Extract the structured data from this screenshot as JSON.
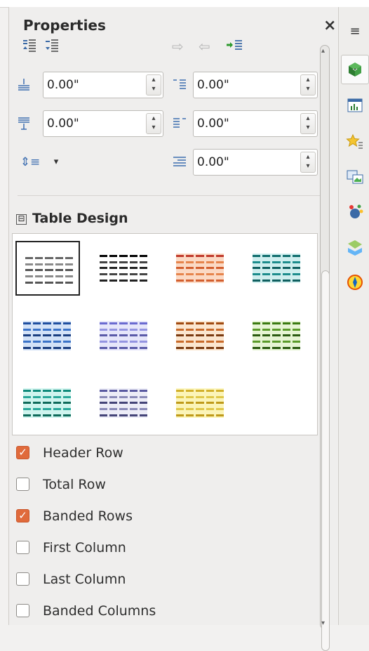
{
  "panel": {
    "title": "Properties",
    "close_glyph": "×"
  },
  "toolbar": {
    "icons": [
      "insert-rows-above-icon",
      "insert-rows-below-icon",
      "indent-increase-icon",
      "indent-decrease-icon",
      "paragraph-after-icon"
    ]
  },
  "spacing": {
    "above": "0.00\"",
    "below": "0.00\"",
    "indent_before": "0.00\"",
    "indent_after": "0.00\"",
    "first_line": "0.00\"",
    "line_spacing_glyph": "⇕≡",
    "dropdown_glyph": "▾"
  },
  "table_design": {
    "title": "Table Design",
    "toggle_glyph": "⊟",
    "styles": [
      {
        "header": "#666666",
        "body": "#8a8a8a",
        "alt": "#555555",
        "bg": "#ffffff",
        "selected": true
      },
      {
        "header": "#000000",
        "body": "#444444",
        "alt": "#222222",
        "bg": "#ffffff",
        "selected": false
      },
      {
        "header": "#c0392b",
        "body": "#e6844c",
        "alt": "#d35f2f",
        "bg": "#fbd9c4",
        "selected": false
      },
      {
        "header": "#0f6c6c",
        "body": "#1c8c8c",
        "alt": "#0f5f5f",
        "bg": "#cfeeee",
        "selected": false
      },
      {
        "header": "#1f4fa0",
        "body": "#3a73c8",
        "alt": "#1a3e80",
        "bg": "#d3e2f7",
        "selected": false
      },
      {
        "header": "#6a6ad0",
        "body": "#9494e0",
        "alt": "#5a5aa8",
        "bg": "#e6e6fa",
        "selected": false
      },
      {
        "header": "#a04a10",
        "body": "#c86a2a",
        "alt": "#7a3a10",
        "bg": "#fbe6cf",
        "selected": false
      },
      {
        "header": "#3a7a10",
        "body": "#5a9a2a",
        "alt": "#2a5a10",
        "bg": "#e6f4d3",
        "selected": false
      },
      {
        "header": "#0f8a7a",
        "body": "#2aa89a",
        "alt": "#0f6a5a",
        "bg": "#cff4ee",
        "selected": false
      },
      {
        "header": "#5a5aa0",
        "body": "#8a8ab8",
        "alt": "#444478",
        "bg": "#ececf7",
        "selected": false
      },
      {
        "header": "#d2b02a",
        "body": "#e0c84a",
        "alt": "#bf9a1a",
        "bg": "#fbf4b8",
        "selected": false
      }
    ]
  },
  "options": [
    {
      "label": "Header Row",
      "checked": true
    },
    {
      "label": "Total Row",
      "checked": false
    },
    {
      "label": "Banded Rows",
      "checked": true
    },
    {
      "label": "First Column",
      "checked": false
    },
    {
      "label": "Last Column",
      "checked": false
    },
    {
      "label": "Banded Columns",
      "checked": false
    }
  ],
  "deck": {
    "menu_glyph": "≡",
    "items": [
      "properties-icon",
      "page-icon",
      "styles-icon",
      "gallery-icon",
      "navigator-icon",
      "manage-changes-icon",
      "compass-icon"
    ]
  }
}
